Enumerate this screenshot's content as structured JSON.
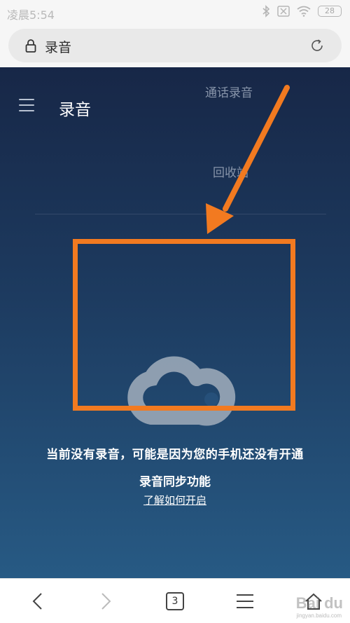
{
  "status_bar": {
    "time": "凌晨5:54",
    "battery": "28",
    "icons": [
      "bluetooth-icon",
      "no-sim-icon",
      "wifi-icon",
      "battery-icon"
    ]
  },
  "address_bar": {
    "url_text": "录音",
    "icons": [
      "lock-icon",
      "reload-icon"
    ]
  },
  "app": {
    "title": "录音",
    "tabs": [
      {
        "label": "通话录音"
      },
      {
        "label": "回收站"
      }
    ],
    "empty_message_line1": "当前没有录音，可能是因为您的手机还没有开通",
    "empty_message_line2": "录音同步功能",
    "help_link": "了解如何开启"
  },
  "bottom_nav": {
    "tab_count": "3",
    "icons": [
      "back-icon",
      "forward-icon",
      "tabs-icon",
      "menu-icon",
      "home-icon"
    ]
  },
  "watermark": {
    "text": "Bai du",
    "sub": "jingyan.baidu.com"
  },
  "colors": {
    "annotation": "#f27a20",
    "page_top": "#172747",
    "page_bottom": "#275a84"
  }
}
